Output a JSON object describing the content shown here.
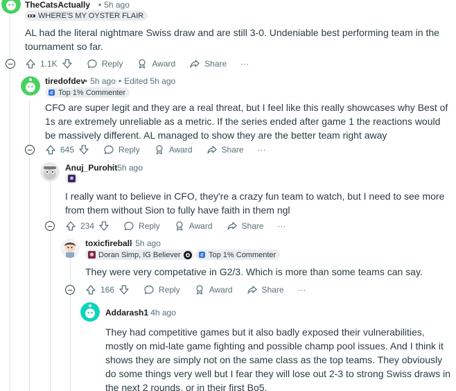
{
  "comments": [
    {
      "username": "TheCatsActually",
      "time": "5h ago",
      "flair": "WHERE'S MY OYSTER FLAIR",
      "text": "AL had the literal nightmare Swiss draw and are still 3-0. Undeniable best performing team in the tournament so far.",
      "votes": "1.1K"
    },
    {
      "username": "tiredofdev",
      "time": "5h ago",
      "edited": "Edited 5h ago",
      "flair": "Top 1% Commenter",
      "text": "CFO are super legit and they are a real threat, but I feel like this really showcases why Best of 1s are extremely unreliable as a metric. If the series ended after game 1 the reactions would be massively different. AL managed to show they are the better team right away",
      "votes": "645"
    },
    {
      "username": "Anuj_Purohit",
      "time": "5h ago",
      "text": "I really want to believe in CFO, they're a crazy fun team to watch, but I need to see more from them without Sion to fully have faith in them ngl",
      "votes": "234"
    },
    {
      "username": "toxicfireball",
      "time": "5h ago",
      "flair": "Doran Simp, IG Believer",
      "flair2": "Top 1% Commenter",
      "text": "They were very competative in G2/3. Which is more than some teams can say.",
      "votes": "166"
    },
    {
      "username": "Addarash1",
      "time": "4h ago",
      "text": "They had competitive games but it also badly exposed their vulnerabilities, mostly on mid-late game fighting and possible champ pool issues. And I think it shows they are simply not on the same class as the top teams. They obviously do some things very well but I fear they will lose out 2-3 to strong Swiss draws in the next 2 rounds, or in their first Bo5."
    }
  ],
  "actions": {
    "reply": "Reply",
    "award": "Award",
    "share": "Share",
    "more": "···"
  },
  "separator": "•",
  "colors": {
    "avatar_green": "#46d160",
    "avatar_blue": "#0dd3bb",
    "thread_line": "#dfe3e6",
    "meta": "#576f76"
  }
}
